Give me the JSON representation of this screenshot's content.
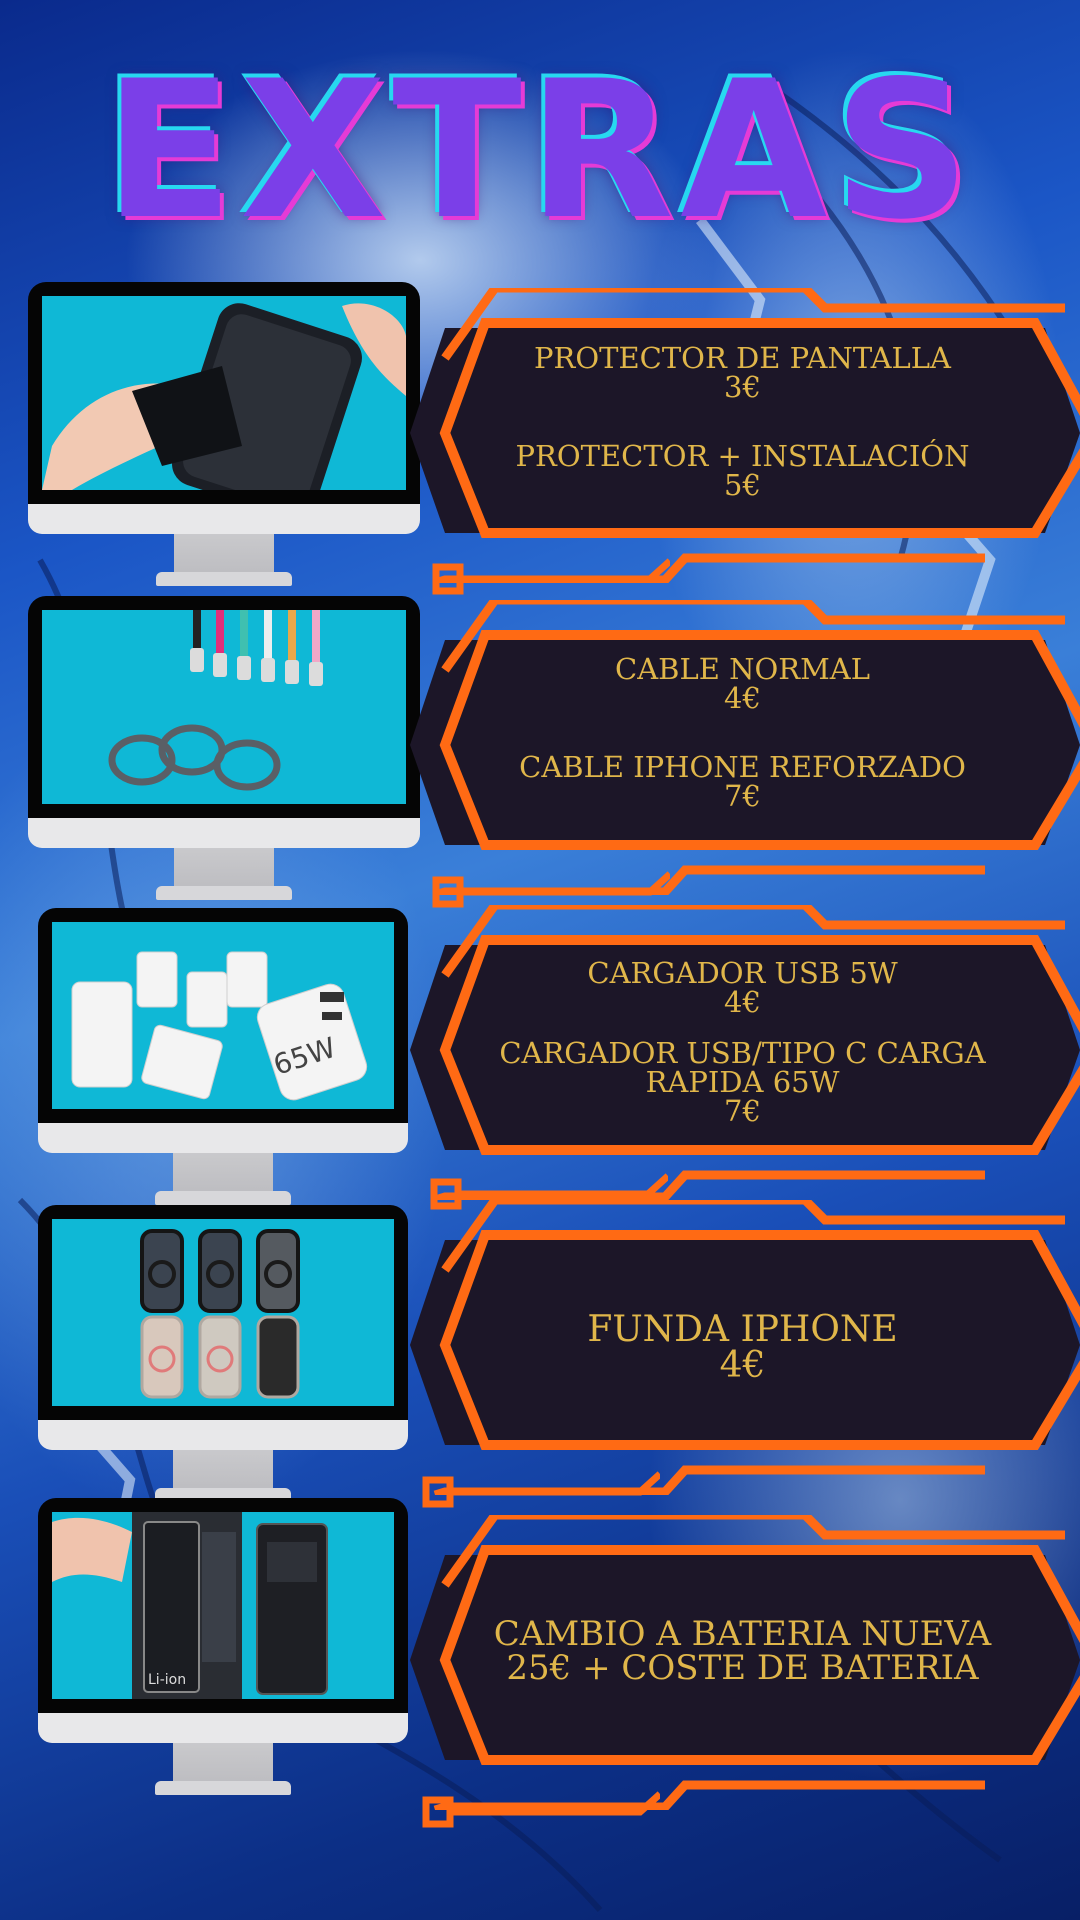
{
  "title": "EXTRAS",
  "colors": {
    "title_fill": "#7b3fe8",
    "title_outline_top": "#27d8f0",
    "title_outline_bottom": "#e53bd6",
    "panel_bg": "#1c1628",
    "panel_border": "#ff6a14",
    "price_text": "#e0b64a",
    "screen_bg": "#08b4d4"
  },
  "items": [
    {
      "image": "screen-protector-photo",
      "lines": [
        "PROTECTOR DE PANTALLA",
        "3€",
        "",
        "PROTECTOR + INSTALACIÓN",
        "5€"
      ]
    },
    {
      "image": "charging-cables-photo",
      "lines": [
        "CABLE NORMAL",
        "4€",
        "",
        "CABLE IPHONE REFORZADO",
        "7€"
      ]
    },
    {
      "image": "usb-chargers-photo",
      "charger_label": "65W",
      "lines": [
        "CARGADOR USB 5W",
        "4€",
        "",
        "CARGADOR USB/TIPO C CARGA",
        "RAPIDA 65W",
        "7€"
      ]
    },
    {
      "image": "iphone-cases-photo",
      "lines": [
        "FUNDA IPHONE",
        "4€"
      ]
    },
    {
      "image": "iphone-battery-photo",
      "battery_label": "Li-ion",
      "lines": [
        "CAMBIO A BATERIA NUEVA",
        "25€ + COSTE DE BATERIA"
      ]
    }
  ]
}
